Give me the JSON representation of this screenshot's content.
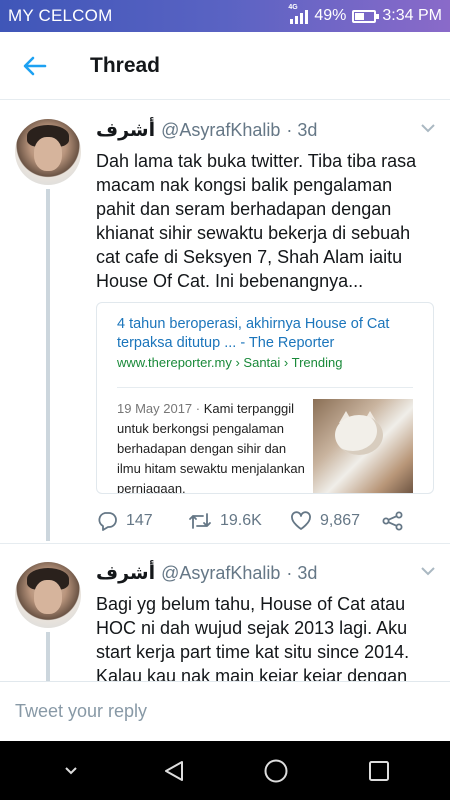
{
  "status_bar": {
    "carrier": "MY CELCOM",
    "network": "4G",
    "battery_percent": "49%",
    "battery_level": 0.49,
    "time": "3:34 PM"
  },
  "header": {
    "title": "Thread",
    "back_icon": "arrow-left-icon"
  },
  "tweets": [
    {
      "name": "أشرف",
      "handle": "@AsyrafKhalib",
      "time": "· 3d",
      "text": "Dah lama tak buka twitter. Tiba tiba rasa macam nak kongsi balik pengalaman pahit dan seram berhadapan dengan khianat sihir sewaktu bekerja di sebuah cat cafe di Seksyen 7, Shah Alam iaitu House Of Cat. Ini bebenangnya...",
      "card": {
        "title": "4 tahun beroperasi, akhirnya House of Cat terpaksa ditutup ... - The Reporter",
        "url": "www.thereporter.my › Santai › Trending",
        "date": "19 May 2017 ·",
        "snippet": "Kami terpanggil untuk berkongsi pengalaman berhadapan dengan sihir dan ilmu hitam sewaktu menjalankan perniagaan."
      },
      "actions": {
        "replies": "147",
        "retweets": "19.6K",
        "likes": "9,867"
      }
    },
    {
      "name": "أشرف",
      "handle": "@AsyrafKhalib",
      "time": "· 3d",
      "text": "Bagi yg belum tahu, House of Cat atau HOC ni dah wujud sejak 2013 lagi. Aku start kerja part time kat situ since 2014. Kalau kau nak main kejar kejar dengan"
    }
  ],
  "reply": {
    "placeholder": "Tweet your reply"
  },
  "accent_color": "#1da1f2"
}
